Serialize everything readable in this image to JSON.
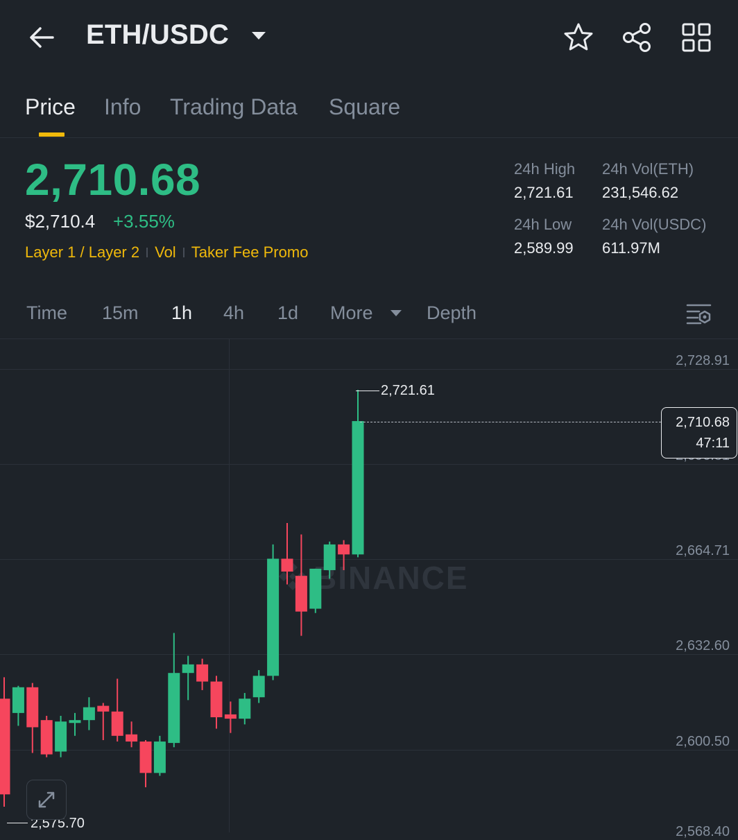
{
  "header": {
    "pair": "ETH/USDC"
  },
  "tabs": [
    {
      "label": "Price",
      "active": true
    },
    {
      "label": "Info",
      "active": false
    },
    {
      "label": "Trading Data",
      "active": false
    },
    {
      "label": "Square",
      "active": false
    }
  ],
  "ticker": {
    "last_price": "2,710.68",
    "usd_price": "$2,710.4",
    "change_pct": "+3.55%",
    "tags": [
      "Layer 1 / Layer 2",
      "Vol",
      "Taker Fee Promo"
    ]
  },
  "stats": {
    "high_label": "24h High",
    "high_value": "2,721.61",
    "low_label": "24h Low",
    "low_value": "2,589.99",
    "vol_base_label": "24h Vol(ETH)",
    "vol_base_value": "231,546.62",
    "vol_quote_label": "24h Vol(USDC)",
    "vol_quote_value": "611.97M"
  },
  "timeframes": [
    {
      "label": "Time",
      "active": false
    },
    {
      "label": "15m",
      "active": false
    },
    {
      "label": "1h",
      "active": true
    },
    {
      "label": "4h",
      "active": false
    },
    {
      "label": "1d",
      "active": false
    },
    {
      "label": "More",
      "active": false
    },
    {
      "label": "Depth",
      "active": false
    }
  ],
  "colors": {
    "up": "#2ebd85",
    "down": "#f6465d",
    "accent": "#f0b90b"
  },
  "chart_data": {
    "type": "candlestick",
    "y_axis_labels": [
      "2,728.91",
      "2,696.81",
      "2,664.71",
      "2,632.60",
      "2,600.50",
      "2,568.40"
    ],
    "ylim": [
      2568.4,
      2728.91
    ],
    "high_marker": "2,721.61",
    "low_marker": "2,575.70",
    "current_price": "2,710.68",
    "countdown": "47:11",
    "watermark": "BINANCE",
    "candles": [
      {
        "o": 2613.5,
        "h": 2621.0,
        "l": 2575.7,
        "c": 2580.0
      },
      {
        "o": 2608.5,
        "h": 2618.0,
        "l": 2604.0,
        "c": 2617.5
      },
      {
        "o": 2617.5,
        "h": 2619.0,
        "l": 2594.5,
        "c": 2603.5
      },
      {
        "o": 2606.0,
        "h": 2607.5,
        "l": 2593.0,
        "c": 2594.0
      },
      {
        "o": 2595.0,
        "h": 2607.5,
        "l": 2593.0,
        "c": 2605.5
      },
      {
        "o": 2605.0,
        "h": 2608.5,
        "l": 2600.5,
        "c": 2606.0
      },
      {
        "o": 2606.0,
        "h": 2614.0,
        "l": 2602.5,
        "c": 2610.5
      },
      {
        "o": 2611.0,
        "h": 2612.0,
        "l": 2599.0,
        "c": 2609.0
      },
      {
        "o": 2609.0,
        "h": 2620.5,
        "l": 2598.5,
        "c": 2600.5
      },
      {
        "o": 2601.0,
        "h": 2605.5,
        "l": 2596.5,
        "c": 2598.5
      },
      {
        "o": 2598.5,
        "h": 2599.0,
        "l": 2582.5,
        "c": 2587.5
      },
      {
        "o": 2587.5,
        "h": 2600.5,
        "l": 2586.5,
        "c": 2598.5
      },
      {
        "o": 2598.0,
        "h": 2636.5,
        "l": 2596.5,
        "c": 2622.5
      },
      {
        "o": 2622.5,
        "h": 2628.5,
        "l": 2613.0,
        "c": 2625.5
      },
      {
        "o": 2625.5,
        "h": 2627.5,
        "l": 2616.5,
        "c": 2619.5
      },
      {
        "o": 2619.5,
        "h": 2621.5,
        "l": 2603.0,
        "c": 2607.0
      },
      {
        "o": 2608.0,
        "h": 2612.5,
        "l": 2601.5,
        "c": 2606.5
      },
      {
        "o": 2606.5,
        "h": 2615.5,
        "l": 2604.5,
        "c": 2613.5
      },
      {
        "o": 2614.0,
        "h": 2623.5,
        "l": 2612.0,
        "c": 2621.5
      },
      {
        "o": 2621.5,
        "h": 2667.5,
        "l": 2620.0,
        "c": 2662.5
      },
      {
        "o": 2662.5,
        "h": 2675.0,
        "l": 2653.5,
        "c": 2658.0
      },
      {
        "o": 2656.5,
        "h": 2671.0,
        "l": 2635.5,
        "c": 2644.0
      },
      {
        "o": 2645.0,
        "h": 2659.0,
        "l": 2643.5,
        "c": 2659.0
      },
      {
        "o": 2658.5,
        "h": 2668.5,
        "l": 2655.5,
        "c": 2667.5
      },
      {
        "o": 2667.5,
        "h": 2669.0,
        "l": 2658.5,
        "c": 2664.0
      },
      {
        "o": 2664.0,
        "h": 2721.61,
        "l": 2663.0,
        "c": 2710.68
      }
    ]
  }
}
